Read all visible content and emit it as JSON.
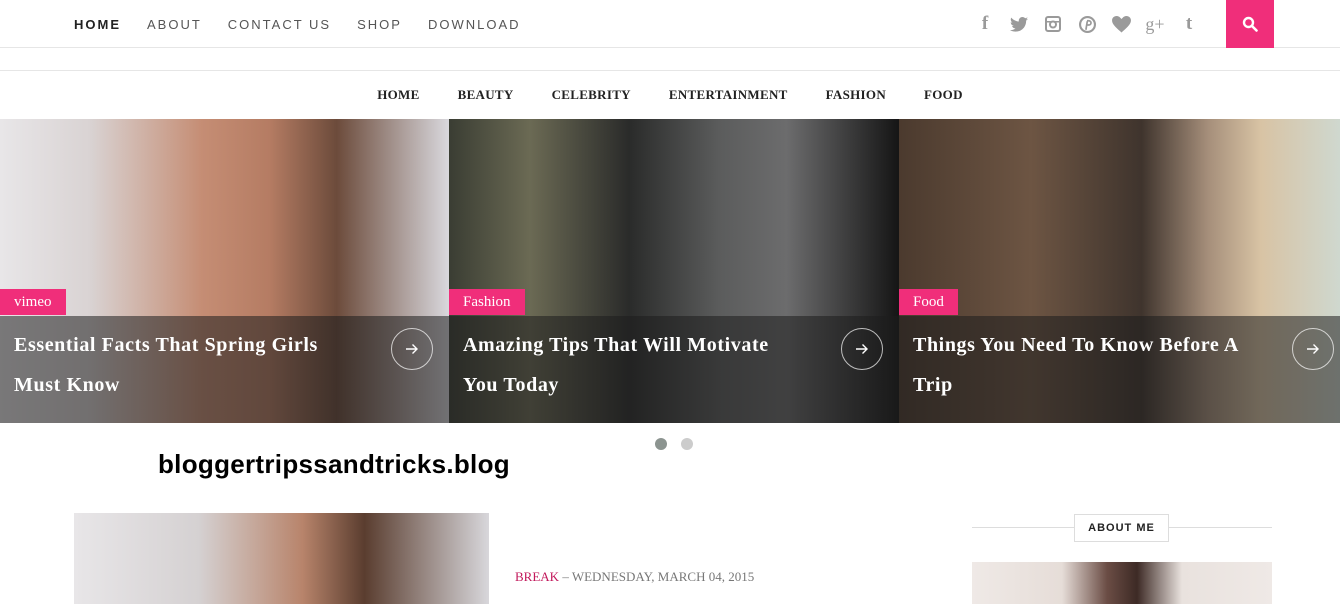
{
  "top_nav": {
    "items": [
      "HOME",
      "ABOUT",
      "CONTACT US",
      "SHOP",
      "DOWNLOAD"
    ]
  },
  "social_icons": [
    "facebook-icon",
    "twitter-icon",
    "instagram-icon",
    "pinterest-icon",
    "bloglovin-heart-icon",
    "google-plus-icon",
    "tumblr-icon"
  ],
  "social_glyphs": [
    "f",
    "t",
    "◙",
    "℗",
    "♥",
    "g+",
    "t"
  ],
  "search": {
    "icon": "search-icon"
  },
  "category_nav": {
    "items": [
      "HOME",
      "BEAUTY",
      "CELEBRITY",
      "ENTERTAINMENT",
      "FASHION",
      "FOOD"
    ]
  },
  "slider": {
    "slides": [
      {
        "tag": "vimeo",
        "title": "Essential Facts That Spring Girls Must Know"
      },
      {
        "tag": "Fashion",
        "title": "Amazing Tips That Will Motivate You Today"
      },
      {
        "tag": "Food",
        "title": "Things You Need To Know Before A Trip"
      }
    ],
    "active_dot": 1,
    "dot_count": 2
  },
  "watermark": "bloggertripssandtricks.blog",
  "post": {
    "category": "BREAK",
    "separator": " – ",
    "date": "WEDNESDAY, MARCH 04, 2015"
  },
  "sidebar": {
    "about_heading": "ABOUT ME"
  },
  "colors": {
    "accent": "#f02e7a",
    "category_link": "#c2185b"
  }
}
